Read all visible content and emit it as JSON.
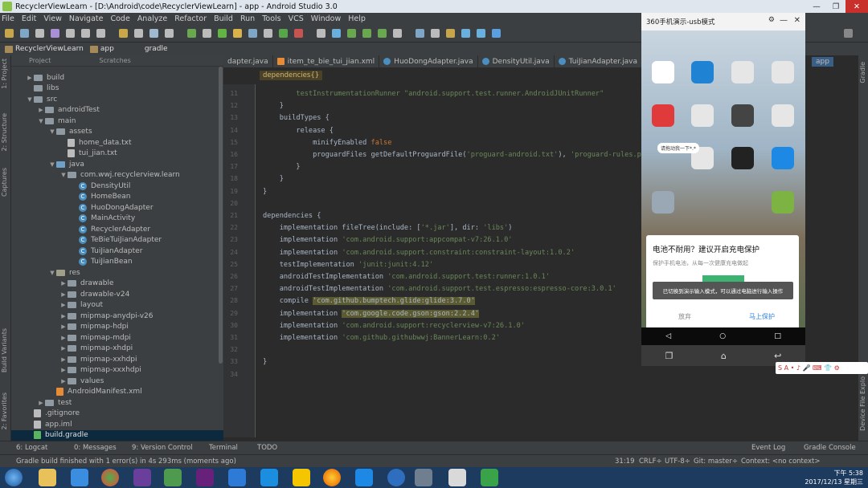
{
  "window": {
    "title": "RecyclerViewLearn - [D:\\Android\\code\\RecyclerViewLearn] - app - Android Studio 3.0"
  },
  "menu": [
    "File",
    "Edit",
    "View",
    "Navigate",
    "Code",
    "Analyze",
    "Refactor",
    "Build",
    "Run",
    "Tools",
    "VCS",
    "Window",
    "Help"
  ],
  "nav": {
    "project": "RecyclerViewLearn",
    "module": "app",
    "file": "gradle"
  },
  "project_panel": {
    "header": "Project",
    "scratches": "Scratches"
  },
  "tree": [
    {
      "label": "build",
      "depth": 2,
      "type": "folder",
      "arrow": "▶"
    },
    {
      "label": "libs",
      "depth": 2,
      "type": "folder",
      "arrow": ""
    },
    {
      "label": "src",
      "depth": 2,
      "type": "folder",
      "arrow": "▼"
    },
    {
      "label": "androidTest",
      "depth": 3,
      "type": "folder",
      "arrow": "▶"
    },
    {
      "label": "main",
      "depth": 3,
      "type": "folder",
      "arrow": "▼"
    },
    {
      "label": "assets",
      "depth": 4,
      "type": "folder",
      "arrow": "▼"
    },
    {
      "label": "home_data.txt",
      "depth": 5,
      "type": "file",
      "arrow": ""
    },
    {
      "label": "tui_jian.txt",
      "depth": 5,
      "type": "file",
      "arrow": ""
    },
    {
      "label": "java",
      "depth": 4,
      "type": "src",
      "arrow": "▼"
    },
    {
      "label": "com.wwj.recyclerview.learn",
      "depth": 5,
      "type": "folder",
      "arrow": "▼"
    },
    {
      "label": "DensityUtil",
      "depth": 6,
      "type": "class",
      "arrow": ""
    },
    {
      "label": "HomeBean",
      "depth": 6,
      "type": "class",
      "arrow": ""
    },
    {
      "label": "HuoDongAdapter",
      "depth": 6,
      "type": "class",
      "arrow": ""
    },
    {
      "label": "MainActivity",
      "depth": 6,
      "type": "class",
      "arrow": ""
    },
    {
      "label": "RecyclerAdapter",
      "depth": 6,
      "type": "class",
      "arrow": ""
    },
    {
      "label": "TeBieTuiJianAdapter",
      "depth": 6,
      "type": "class",
      "arrow": ""
    },
    {
      "label": "TuiJianAdapter",
      "depth": 6,
      "type": "class",
      "arrow": ""
    },
    {
      "label": "TuiJianBean",
      "depth": 6,
      "type": "class",
      "arrow": ""
    },
    {
      "label": "res",
      "depth": 4,
      "type": "res",
      "arrow": "▼"
    },
    {
      "label": "drawable",
      "depth": 5,
      "type": "folder",
      "arrow": "▶"
    },
    {
      "label": "drawable-v24",
      "depth": 5,
      "type": "folder",
      "arrow": "▶"
    },
    {
      "label": "layout",
      "depth": 5,
      "type": "folder",
      "arrow": "▶"
    },
    {
      "label": "mipmap-anydpi-v26",
      "depth": 5,
      "type": "folder",
      "arrow": "▶"
    },
    {
      "label": "mipmap-hdpi",
      "depth": 5,
      "type": "folder",
      "arrow": "▶"
    },
    {
      "label": "mipmap-mdpi",
      "depth": 5,
      "type": "folder",
      "arrow": "▶"
    },
    {
      "label": "mipmap-xhdpi",
      "depth": 5,
      "type": "folder",
      "arrow": "▶"
    },
    {
      "label": "mipmap-xxhdpi",
      "depth": 5,
      "type": "folder",
      "arrow": "▶"
    },
    {
      "label": "mipmap-xxxhdpi",
      "depth": 5,
      "type": "folder",
      "arrow": "▶"
    },
    {
      "label": "values",
      "depth": 5,
      "type": "folder",
      "arrow": "▶"
    },
    {
      "label": "AndroidManifest.xml",
      "depth": 4,
      "type": "xml",
      "arrow": ""
    },
    {
      "label": "test",
      "depth": 3,
      "type": "folder",
      "arrow": "▶"
    },
    {
      "label": ".gitignore",
      "depth": 2,
      "type": "file",
      "arrow": ""
    },
    {
      "label": "app.iml",
      "depth": 2,
      "type": "file",
      "arrow": ""
    },
    {
      "label": "build.gradle",
      "depth": 2,
      "type": "gradle",
      "arrow": "",
      "selected": true
    }
  ],
  "tabs": [
    "dapter.java",
    "item_te_bie_tui_jian.xml",
    "HuoDongAdapter.java",
    "DensityUtil.java",
    "TuiJianAdapter.java"
  ],
  "breadcrumb_chip": "dependencies{}",
  "code": [
    {
      "n": "11",
      "parts": [
        [
          "",
          "        "
        ],
        [
          "st",
          "testInstrumentationRunner \"android.support.test.runner.AndroidJUnitRunner\""
        ]
      ]
    },
    {
      "n": "12",
      "parts": [
        [
          "",
          "    }"
        ]
      ]
    },
    {
      "n": "13",
      "parts": [
        [
          "",
          "    buildTypes {"
        ]
      ]
    },
    {
      "n": "14",
      "parts": [
        [
          "",
          "        release {"
        ]
      ]
    },
    {
      "n": "15",
      "parts": [
        [
          "",
          "            minifyEnabled "
        ],
        [
          "kw",
          "false"
        ]
      ]
    },
    {
      "n": "16",
      "parts": [
        [
          "",
          "            proguardFiles getDefaultProguardFile("
        ],
        [
          "st",
          "'proguard-android.txt'"
        ],
        [
          "",
          "), "
        ],
        [
          "st",
          "'proguard-rules.pro'"
        ]
      ]
    },
    {
      "n": "17",
      "parts": [
        [
          "",
          "        }"
        ]
      ]
    },
    {
      "n": "18",
      "parts": [
        [
          "",
          "    }"
        ]
      ]
    },
    {
      "n": "19",
      "parts": [
        [
          "",
          "}"
        ]
      ]
    },
    {
      "n": "20",
      "parts": [
        [
          "",
          ""
        ]
      ]
    },
    {
      "n": "21",
      "parts": [
        [
          "",
          "dependencies {"
        ]
      ]
    },
    {
      "n": "22",
      "parts": [
        [
          "",
          "    implementation fileTree(include: ["
        ],
        [
          "st",
          "'*.jar'"
        ],
        [
          "",
          "], dir: "
        ],
        [
          "st",
          "'libs'"
        ],
        [
          "",
          ")"
        ]
      ]
    },
    {
      "n": "23",
      "parts": [
        [
          "",
          "    implementation "
        ],
        [
          "st",
          "'com.android.support:appcompat-v7:26.1.0'"
        ]
      ]
    },
    {
      "n": "24",
      "parts": [
        [
          "",
          "    implementation "
        ],
        [
          "st",
          "'com.android.support.constraint:constraint-layout:1.0.2'"
        ]
      ]
    },
    {
      "n": "25",
      "parts": [
        [
          "",
          "    testImplementation "
        ],
        [
          "st",
          "'junit:junit:4.12'"
        ]
      ]
    },
    {
      "n": "26",
      "parts": [
        [
          "",
          "    androidTestImplementation "
        ],
        [
          "st",
          "'com.android.support.test:runner:1.0.1'"
        ]
      ]
    },
    {
      "n": "27",
      "parts": [
        [
          "",
          "    androidTestImplementation "
        ],
        [
          "st",
          "'com.android.support.test.espresso:espresso-core:3.0.1'"
        ]
      ]
    },
    {
      "n": "28",
      "parts": [
        [
          "",
          "    compile "
        ],
        [
          "hl",
          "'com.github.bumptech.glide:glide:3.7.0'"
        ]
      ]
    },
    {
      "n": "29",
      "parts": [
        [
          "",
          "    implementation "
        ],
        [
          "hl",
          "'com.google.code.gson:gson:2.2.4'"
        ]
      ]
    },
    {
      "n": "30",
      "parts": [
        [
          "",
          "    implementation "
        ],
        [
          "st",
          "'com.android.support:recyclerview-v7:26.1.0'"
        ]
      ]
    },
    {
      "n": "31",
      "parts": [
        [
          "",
          "    implementation "
        ],
        [
          "st",
          "'com.github.githubwwj:BannerLearn:0.2'"
        ]
      ]
    },
    {
      "n": "32",
      "parts": [
        [
          "",
          ""
        ]
      ]
    },
    {
      "n": "33",
      "parts": [
        [
          "",
          "}"
        ]
      ]
    },
    {
      "n": "34",
      "parts": [
        [
          "",
          ""
        ]
      ]
    }
  ],
  "phone": {
    "title": "360手机演示-usb模式",
    "app_labels": [
      "时钟",
      "手机管家",
      "",
      "",
      "华为",
      "",
      "",
      "",
      "",
      "",
      "",
      "",
      ""
    ],
    "bubble": "请拖动我一下*.*",
    "dialog_title": "电池不耐用？建议开启充电保护",
    "dialog_sub": "保护手机电池，从每一次健康充电做起",
    "toast": "已切换到演示输入模式，可以通过电脑进行输入操作",
    "cancel": "放弃",
    "confirm": "马上保护",
    "app_tab": "app"
  },
  "bottom": {
    "logcat": "6: Logcat",
    "messages": "0: Messages",
    "vcs": "9: Version Control",
    "terminal": "Terminal",
    "todo": "TODO",
    "eventlog": "Event Log",
    "gradleconsole": "Gradle Console"
  },
  "status": {
    "message": "Gradle build finished with 1 error(s) in 4s 293ms (moments ago)",
    "pos": "31:19",
    "crlf": "CRLF÷",
    "enc": "UTF-8÷",
    "git": "Git: master÷",
    "context": "Context: <no context>"
  },
  "vtabs": {
    "project": "1: Project",
    "structure": "2: Structure",
    "captures": "Captures",
    "build_variants": "Build Variants",
    "favorites": "2: Favorites",
    "gradle": "Gradle",
    "device_file": "Device File Explo"
  },
  "taskbar": {
    "time": "下午 5:38",
    "date": "2017/12/13 星期三"
  },
  "ime": "S A • ♪ 🎤 ⌨ 👕 ⚙"
}
